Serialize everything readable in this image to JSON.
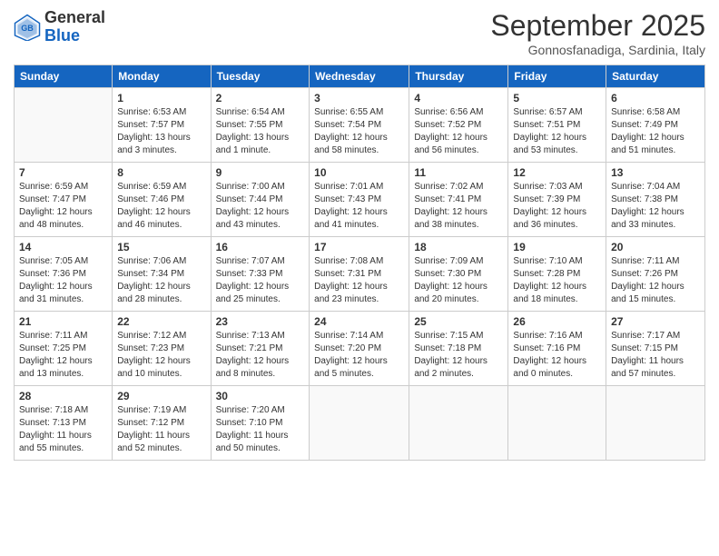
{
  "header": {
    "logo_general": "General",
    "logo_blue": "Blue",
    "month_title": "September 2025",
    "location": "Gonnosfanadiga, Sardinia, Italy"
  },
  "days_of_week": [
    "Sunday",
    "Monday",
    "Tuesday",
    "Wednesday",
    "Thursday",
    "Friday",
    "Saturday"
  ],
  "weeks": [
    [
      {
        "day": "",
        "sunrise": "",
        "sunset": "",
        "daylight": ""
      },
      {
        "day": "1",
        "sunrise": "Sunrise: 6:53 AM",
        "sunset": "Sunset: 7:57 PM",
        "daylight": "Daylight: 13 hours and 3 minutes."
      },
      {
        "day": "2",
        "sunrise": "Sunrise: 6:54 AM",
        "sunset": "Sunset: 7:55 PM",
        "daylight": "Daylight: 13 hours and 1 minute."
      },
      {
        "day": "3",
        "sunrise": "Sunrise: 6:55 AM",
        "sunset": "Sunset: 7:54 PM",
        "daylight": "Daylight: 12 hours and 58 minutes."
      },
      {
        "day": "4",
        "sunrise": "Sunrise: 6:56 AM",
        "sunset": "Sunset: 7:52 PM",
        "daylight": "Daylight: 12 hours and 56 minutes."
      },
      {
        "day": "5",
        "sunrise": "Sunrise: 6:57 AM",
        "sunset": "Sunset: 7:51 PM",
        "daylight": "Daylight: 12 hours and 53 minutes."
      },
      {
        "day": "6",
        "sunrise": "Sunrise: 6:58 AM",
        "sunset": "Sunset: 7:49 PM",
        "daylight": "Daylight: 12 hours and 51 minutes."
      }
    ],
    [
      {
        "day": "7",
        "sunrise": "Sunrise: 6:59 AM",
        "sunset": "Sunset: 7:47 PM",
        "daylight": "Daylight: 12 hours and 48 minutes."
      },
      {
        "day": "8",
        "sunrise": "Sunrise: 6:59 AM",
        "sunset": "Sunset: 7:46 PM",
        "daylight": "Daylight: 12 hours and 46 minutes."
      },
      {
        "day": "9",
        "sunrise": "Sunrise: 7:00 AM",
        "sunset": "Sunset: 7:44 PM",
        "daylight": "Daylight: 12 hours and 43 minutes."
      },
      {
        "day": "10",
        "sunrise": "Sunrise: 7:01 AM",
        "sunset": "Sunset: 7:43 PM",
        "daylight": "Daylight: 12 hours and 41 minutes."
      },
      {
        "day": "11",
        "sunrise": "Sunrise: 7:02 AM",
        "sunset": "Sunset: 7:41 PM",
        "daylight": "Daylight: 12 hours and 38 minutes."
      },
      {
        "day": "12",
        "sunrise": "Sunrise: 7:03 AM",
        "sunset": "Sunset: 7:39 PM",
        "daylight": "Daylight: 12 hours and 36 minutes."
      },
      {
        "day": "13",
        "sunrise": "Sunrise: 7:04 AM",
        "sunset": "Sunset: 7:38 PM",
        "daylight": "Daylight: 12 hours and 33 minutes."
      }
    ],
    [
      {
        "day": "14",
        "sunrise": "Sunrise: 7:05 AM",
        "sunset": "Sunset: 7:36 PM",
        "daylight": "Daylight: 12 hours and 31 minutes."
      },
      {
        "day": "15",
        "sunrise": "Sunrise: 7:06 AM",
        "sunset": "Sunset: 7:34 PM",
        "daylight": "Daylight: 12 hours and 28 minutes."
      },
      {
        "day": "16",
        "sunrise": "Sunrise: 7:07 AM",
        "sunset": "Sunset: 7:33 PM",
        "daylight": "Daylight: 12 hours and 25 minutes."
      },
      {
        "day": "17",
        "sunrise": "Sunrise: 7:08 AM",
        "sunset": "Sunset: 7:31 PM",
        "daylight": "Daylight: 12 hours and 23 minutes."
      },
      {
        "day": "18",
        "sunrise": "Sunrise: 7:09 AM",
        "sunset": "Sunset: 7:30 PM",
        "daylight": "Daylight: 12 hours and 20 minutes."
      },
      {
        "day": "19",
        "sunrise": "Sunrise: 7:10 AM",
        "sunset": "Sunset: 7:28 PM",
        "daylight": "Daylight: 12 hours and 18 minutes."
      },
      {
        "day": "20",
        "sunrise": "Sunrise: 7:11 AM",
        "sunset": "Sunset: 7:26 PM",
        "daylight": "Daylight: 12 hours and 15 minutes."
      }
    ],
    [
      {
        "day": "21",
        "sunrise": "Sunrise: 7:11 AM",
        "sunset": "Sunset: 7:25 PM",
        "daylight": "Daylight: 12 hours and 13 minutes."
      },
      {
        "day": "22",
        "sunrise": "Sunrise: 7:12 AM",
        "sunset": "Sunset: 7:23 PM",
        "daylight": "Daylight: 12 hours and 10 minutes."
      },
      {
        "day": "23",
        "sunrise": "Sunrise: 7:13 AM",
        "sunset": "Sunset: 7:21 PM",
        "daylight": "Daylight: 12 hours and 8 minutes."
      },
      {
        "day": "24",
        "sunrise": "Sunrise: 7:14 AM",
        "sunset": "Sunset: 7:20 PM",
        "daylight": "Daylight: 12 hours and 5 minutes."
      },
      {
        "day": "25",
        "sunrise": "Sunrise: 7:15 AM",
        "sunset": "Sunset: 7:18 PM",
        "daylight": "Daylight: 12 hours and 2 minutes."
      },
      {
        "day": "26",
        "sunrise": "Sunrise: 7:16 AM",
        "sunset": "Sunset: 7:16 PM",
        "daylight": "Daylight: 12 hours and 0 minutes."
      },
      {
        "day": "27",
        "sunrise": "Sunrise: 7:17 AM",
        "sunset": "Sunset: 7:15 PM",
        "daylight": "Daylight: 11 hours and 57 minutes."
      }
    ],
    [
      {
        "day": "28",
        "sunrise": "Sunrise: 7:18 AM",
        "sunset": "Sunset: 7:13 PM",
        "daylight": "Daylight: 11 hours and 55 minutes."
      },
      {
        "day": "29",
        "sunrise": "Sunrise: 7:19 AM",
        "sunset": "Sunset: 7:12 PM",
        "daylight": "Daylight: 11 hours and 52 minutes."
      },
      {
        "day": "30",
        "sunrise": "Sunrise: 7:20 AM",
        "sunset": "Sunset: 7:10 PM",
        "daylight": "Daylight: 11 hours and 50 minutes."
      },
      {
        "day": "",
        "sunrise": "",
        "sunset": "",
        "daylight": ""
      },
      {
        "day": "",
        "sunrise": "",
        "sunset": "",
        "daylight": ""
      },
      {
        "day": "",
        "sunrise": "",
        "sunset": "",
        "daylight": ""
      },
      {
        "day": "",
        "sunrise": "",
        "sunset": "",
        "daylight": ""
      }
    ]
  ]
}
